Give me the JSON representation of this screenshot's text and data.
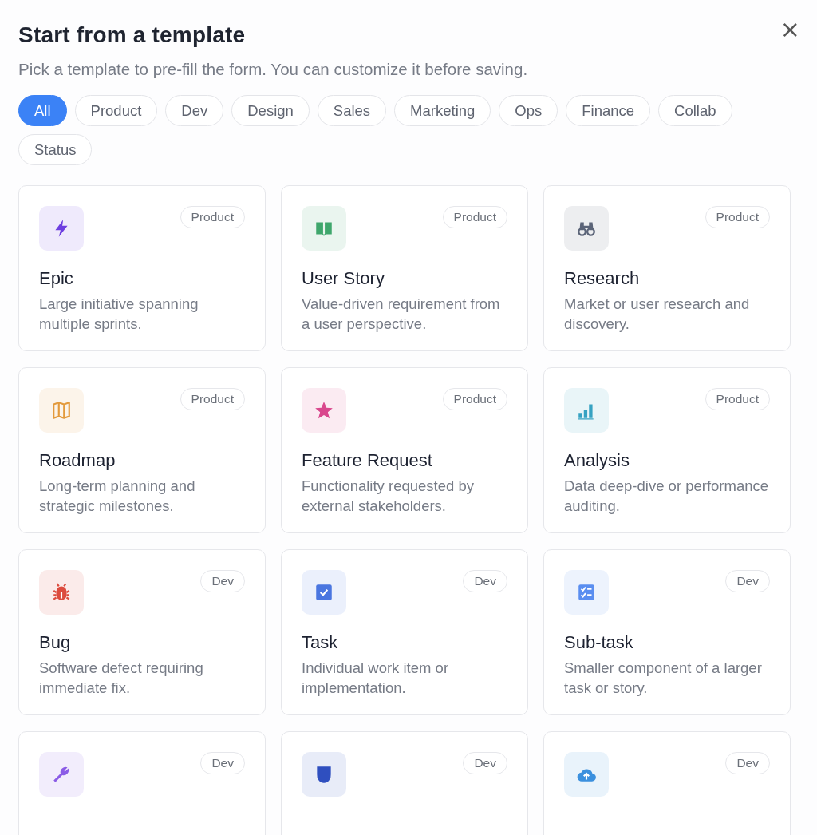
{
  "dialog": {
    "title": "Start from a template",
    "subtitle": "Pick a template to pre-fill the form. You can customize it before saving.",
    "close": "×"
  },
  "filters": [
    {
      "label": "All",
      "selected": true
    },
    {
      "label": "Product",
      "selected": false
    },
    {
      "label": "Dev",
      "selected": false
    },
    {
      "label": "Design",
      "selected": false
    },
    {
      "label": "Sales",
      "selected": false
    },
    {
      "label": "Marketing",
      "selected": false
    },
    {
      "label": "Ops",
      "selected": false
    },
    {
      "label": "Finance",
      "selected": false
    },
    {
      "label": "Collab",
      "selected": false
    },
    {
      "label": "Status",
      "selected": false
    }
  ],
  "templates": [
    {
      "kind": "bolt",
      "color": "#6d3fe0",
      "tag": "Product",
      "title": "Epic",
      "description": "Large initiative spanning multiple sprints."
    },
    {
      "kind": "book",
      "color": "#3fa66c",
      "tag": "Product",
      "title": "User Story",
      "description": "Value-driven requirement from a user perspective."
    },
    {
      "kind": "binoculars",
      "color": "#5b6478",
      "tag": "Product",
      "title": "Research",
      "description": "Market or user research and discovery."
    },
    {
      "kind": "map",
      "color": "#e39a3c",
      "tag": "Product",
      "title": "Roadmap",
      "description": "Long-term planning and strategic milestones."
    },
    {
      "kind": "star",
      "color": "#d9478d",
      "tag": "Product",
      "title": "Feature Request",
      "description": "Functionality requested by external stakeholders."
    },
    {
      "kind": "chart",
      "color": "#36a2c2",
      "tag": "Product",
      "title": "Analysis",
      "description": "Data deep-dive or performance auditing."
    },
    {
      "kind": "bug",
      "color": "#dc4b3e",
      "tag": "Dev",
      "title": "Bug",
      "description": "Software defect requiring immediate fix."
    },
    {
      "kind": "checkbox",
      "color": "#4a76e0",
      "tag": "Dev",
      "title": "Task",
      "description": "Individual work item or implementation."
    },
    {
      "kind": "checklist",
      "color": "#5a8ef0",
      "tag": "Dev",
      "title": "Sub-task",
      "description": "Smaller component of a larger task or story."
    },
    {
      "kind": "wrench",
      "color": "#8b5ce6",
      "tag": "Dev"
    },
    {
      "kind": "shield",
      "color": "#2f4fbf",
      "tag": "Dev"
    },
    {
      "kind": "cloud",
      "color": "#3b90de",
      "tag": "Dev"
    }
  ]
}
